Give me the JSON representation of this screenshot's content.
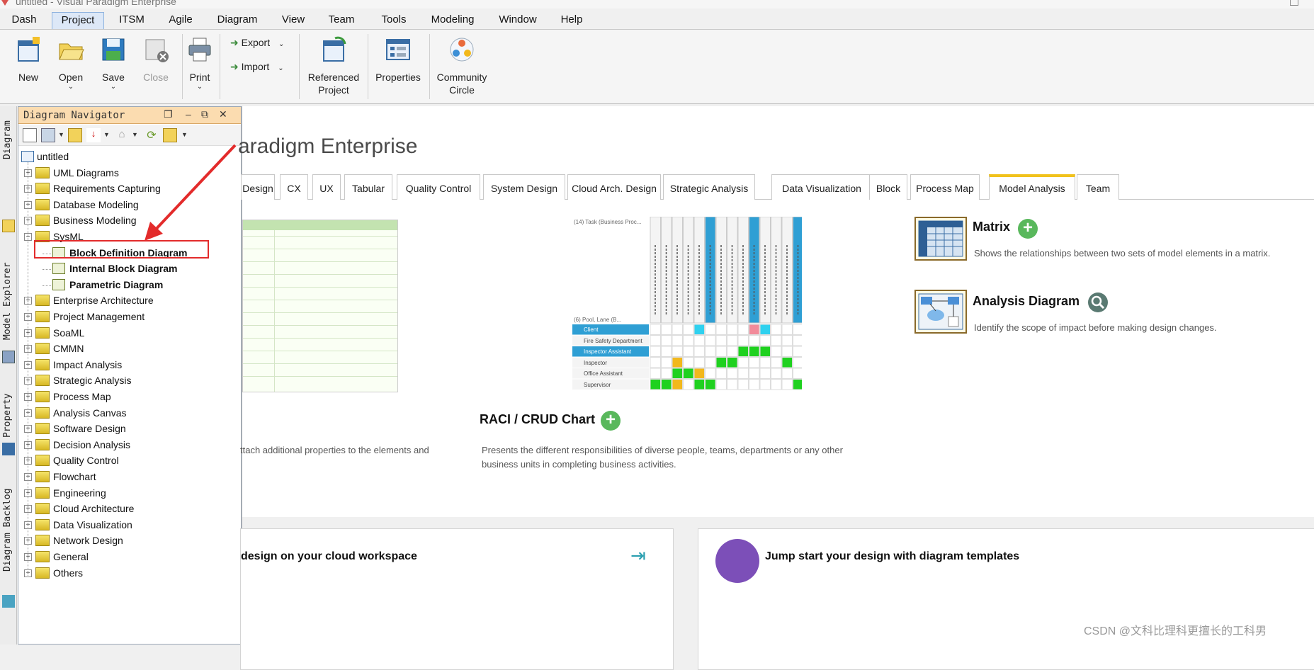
{
  "window": {
    "title": "untitled - Visual Paradigm Enterprise"
  },
  "menu": [
    "Dash",
    "Project",
    "ITSM",
    "Agile",
    "Diagram",
    "View",
    "Team",
    "Tools",
    "Modeling",
    "Window",
    "Help"
  ],
  "ribbon": {
    "new": "New",
    "open": "Open",
    "save": "Save",
    "close": "Close",
    "print": "Print",
    "export": "Export",
    "import": "Import",
    "referenced_1": "Referenced",
    "referenced_2": "Project",
    "properties": "Properties",
    "community_1": "Community",
    "community_2": "Circle"
  },
  "side_tabs": [
    "Diagram Navigator",
    "Model Explorer",
    "Property",
    "Diagram Backlog"
  ],
  "navigator": {
    "title": "Diagram Navigator",
    "root": "untitled",
    "items": [
      "UML Diagrams",
      "Requirements Capturing",
      "Database Modeling",
      "Business Modeling",
      "SysML",
      "Enterprise Architecture",
      "Project Management",
      "SoaML",
      "CMMN",
      "Impact Analysis",
      "Strategic Analysis",
      "Process Map",
      "Analysis Canvas",
      "Software Design",
      "Decision Analysis",
      "Quality Control",
      "Flowchart",
      "Engineering",
      "Cloud Architecture",
      "Data Visualization",
      "Network Design",
      "General",
      "Others"
    ],
    "sysml_children": [
      "Block Definition Diagram",
      "Internal Block Diagram",
      "Parametric Diagram"
    ]
  },
  "content": {
    "header": "aradigm Enterprise",
    "tabs": [
      "Design",
      "CX",
      "UX",
      "Tabular",
      "Quality Control",
      "System Design",
      "Cloud Arch. Design",
      "Strategic Analysis",
      "Data Visualization",
      "Block",
      "Process Map",
      "Model Analysis",
      "Team"
    ],
    "active_tab": "Model Analysis",
    "left_desc": "ttach additional properties to the elements and",
    "raci_title": "RACI / CRUD Chart",
    "raci_desc_1": "Presents the different responsibilities of diverse people, teams, departments or any other",
    "raci_desc_2": "business units in completing business activities.",
    "raci_preview": {
      "header": "(14) Task (Business Proc...",
      "corner": "(6) Pool, Lane (B...",
      "rows": [
        "Client",
        "Fire Safety Department",
        "Inspector Assistant",
        "Inspector",
        "Office Assistant",
        "Supervisor"
      ]
    },
    "matrix_title": "Matrix",
    "matrix_desc": "Shows the relationships between two sets of model elements in a matrix.",
    "analysis_title": "Analysis Diagram",
    "analysis_desc": "Identify the scope of impact before making design changes.",
    "card1": "design on your cloud workspace",
    "card2": "Jump start your design with diagram templates"
  },
  "watermark": "CSDN @文科比理科更擅长的工科男",
  "accent": "#f1c21c"
}
